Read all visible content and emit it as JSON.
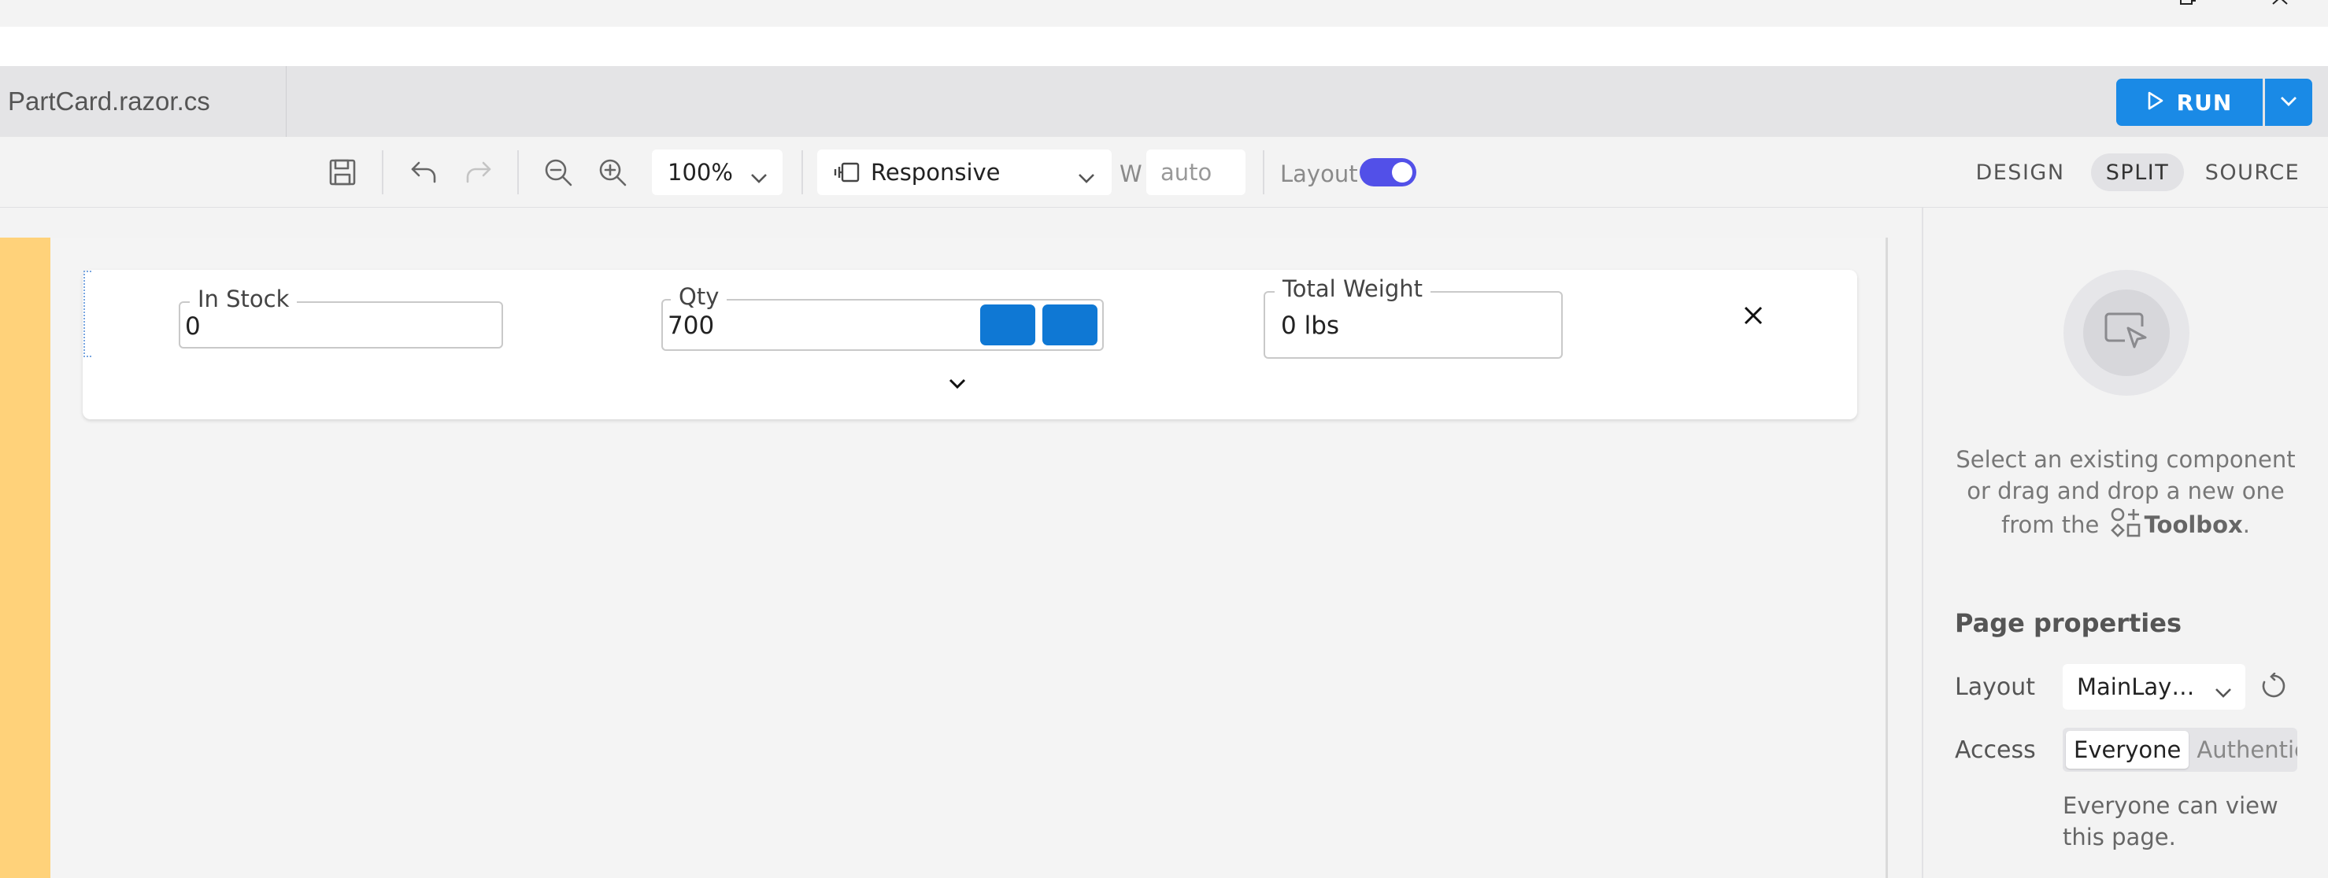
{
  "file_tab": {
    "title": "PartCard.razor.cs"
  },
  "run": {
    "label": "RUN"
  },
  "toolbar": {
    "zoom": "100%",
    "device": "Responsive",
    "width_label": "W",
    "width_value": "auto",
    "layout_label": "Layout",
    "layout_toggle_on": true,
    "modes": [
      "DESIGN",
      "SPLIT",
      "SOURCE"
    ],
    "active_mode": "SPLIT"
  },
  "card": {
    "in_stock": {
      "label": "In Stock",
      "value": "0"
    },
    "qty": {
      "label": "Qty",
      "value": "700"
    },
    "total_weight": {
      "label": "Total Weight",
      "value": "0 lbs"
    }
  },
  "panel": {
    "hint_line1": "Select an existing component",
    "hint_line2": "or drag and drop a new one",
    "hint_line3_pre": "from the",
    "hint_toolbox": "Toolbox",
    "hint_line3_post": ".",
    "page_properties": "Page properties",
    "layout_label": "Layout",
    "layout_value": "MainLay…",
    "access_label": "Access",
    "access_options": [
      "Everyone",
      "Authentica"
    ],
    "access_selected": "Everyone",
    "access_desc": "Everyone can view this page."
  },
  "colors": {
    "accent": "#1a8ae6",
    "toggle": "#5250e8",
    "stepper": "#0f78d4",
    "stripe": "#ffd27a"
  }
}
